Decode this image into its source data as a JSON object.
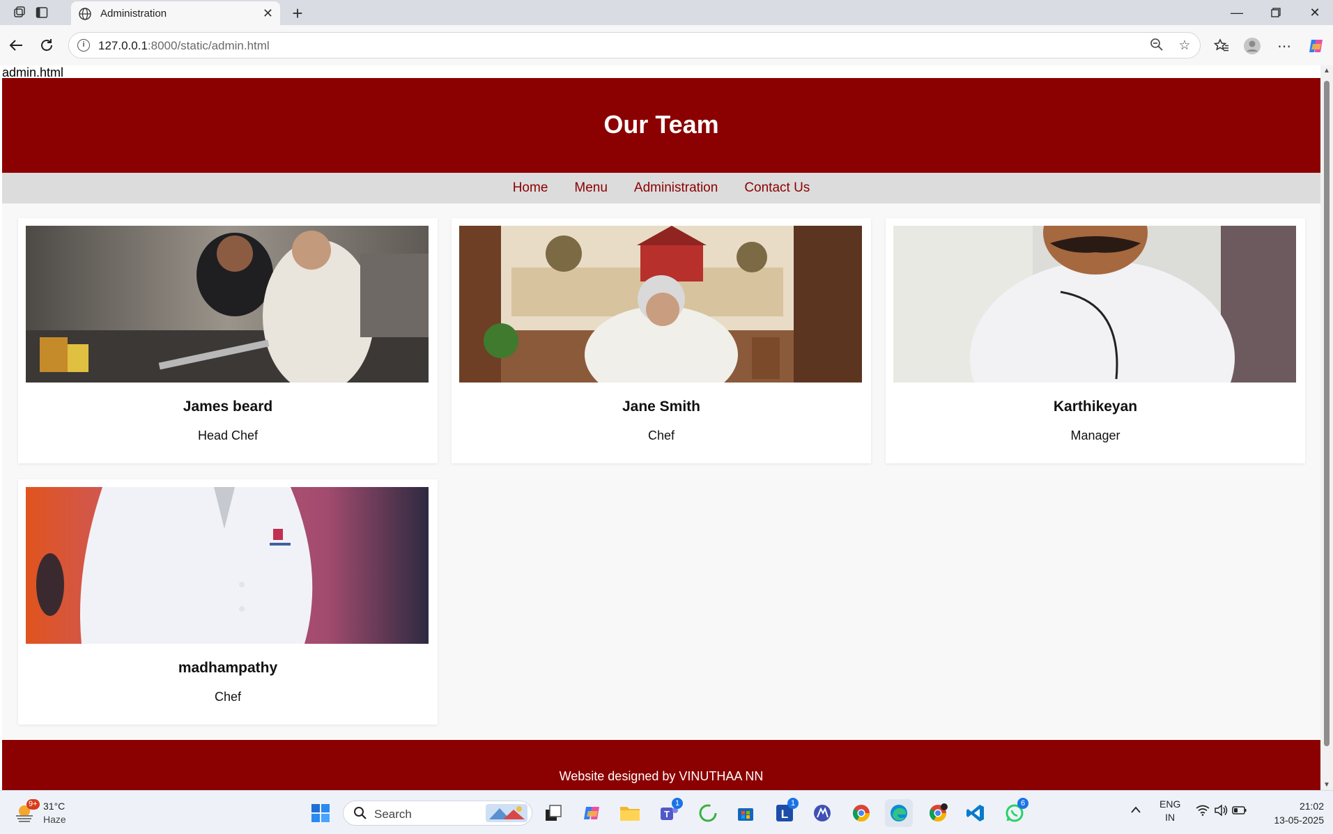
{
  "browser": {
    "tab_title": "Administration",
    "url_host": "127.0.0.1",
    "url_path": ":8000/static/admin.html"
  },
  "page": {
    "filename": "admin.html",
    "heading": "Our Team",
    "nav": [
      "Home",
      "Menu",
      "Administration",
      "Contact Us"
    ],
    "team": [
      {
        "name": "James beard",
        "role": "Head Chef"
      },
      {
        "name": "Jane Smith",
        "role": "Chef"
      },
      {
        "name": "Karthikeyan",
        "role": "Manager"
      },
      {
        "name": "madhampathy",
        "role": "Chef"
      }
    ],
    "footer": "Website designed by VINUTHAA NN"
  },
  "taskbar": {
    "weather_badge": "9+",
    "temperature": "31°C",
    "condition": "Haze",
    "search_placeholder": "Search",
    "teams_badge": "1",
    "l_badge": "1",
    "whatsapp_badge": "6",
    "lang_top": "ENG",
    "lang_bottom": "IN",
    "time": "21:02",
    "date": "13-05-2025"
  },
  "colors": {
    "brand": "#8b0000",
    "nav_bg": "#dcdcdc"
  }
}
